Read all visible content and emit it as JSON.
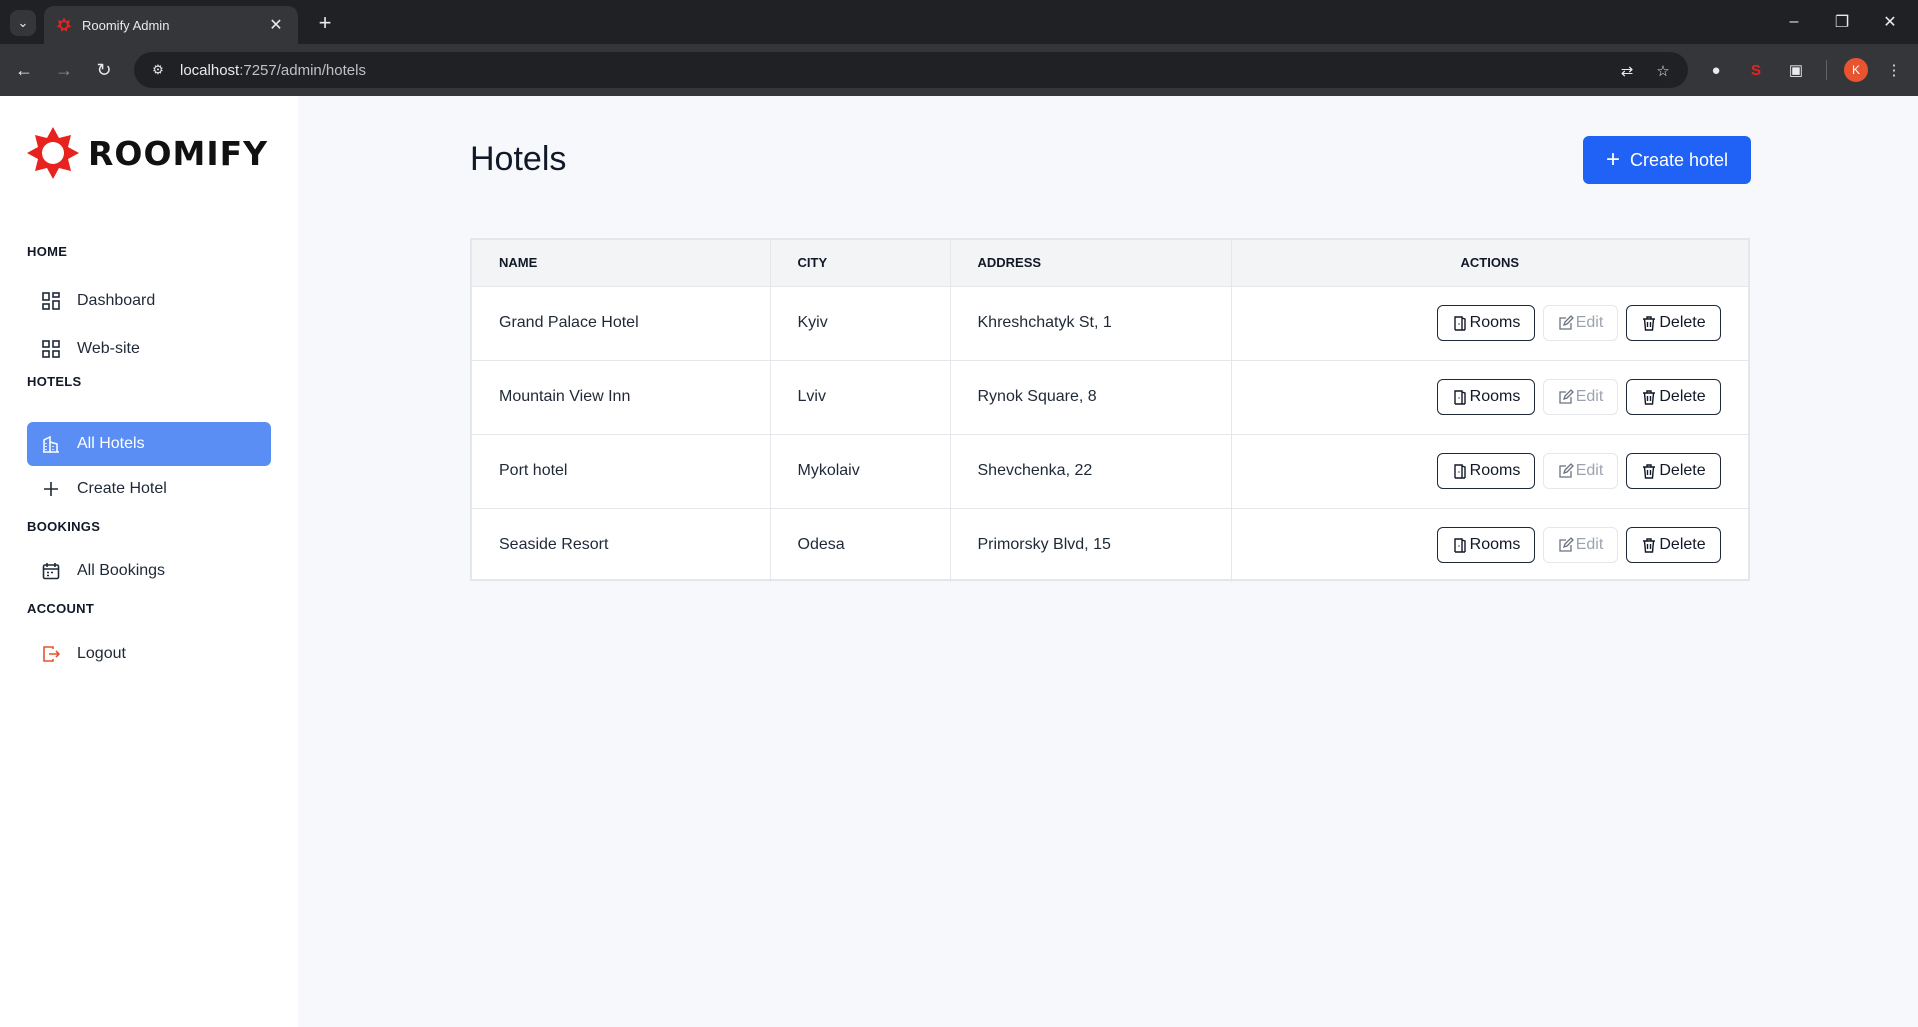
{
  "browser": {
    "tab_title": "Roomify Admin",
    "url_host": "localhost",
    "url_path": ":7257/admin/hotels",
    "profile_initial": "K"
  },
  "sidebar": {
    "logo_text": "ROOMIFY",
    "sections": [
      {
        "title": "HOME",
        "items": [
          {
            "label": "Dashboard",
            "icon": "dashboard-icon"
          },
          {
            "label": "Web-site",
            "icon": "website-icon"
          }
        ]
      },
      {
        "title": "HOTELS",
        "items": [
          {
            "label": "All Hotels",
            "icon": "building-icon",
            "active": true
          },
          {
            "label": "Create Hotel",
            "icon": "plus-icon"
          }
        ]
      },
      {
        "title": "BOOKINGS",
        "items": [
          {
            "label": "All Bookings",
            "icon": "calendar-icon"
          }
        ]
      },
      {
        "title": "ACCOUNT",
        "items": [
          {
            "label": "Logout",
            "icon": "logout-icon"
          }
        ]
      }
    ]
  },
  "main": {
    "title": "Hotels",
    "create_button": "Create hotel",
    "columns": [
      "NAME",
      "CITY",
      "ADDRESS",
      "ACTIONS"
    ],
    "rows": [
      {
        "name": "Grand Palace Hotel",
        "city": "Kyiv",
        "address": "Khreshchatyk St, 1"
      },
      {
        "name": "Mountain View Inn",
        "city": "Lviv",
        "address": "Rynok Square, 8"
      },
      {
        "name": "Port hotel",
        "city": "Mykolaiv",
        "address": "Shevchenka, 22"
      },
      {
        "name": "Seaside Resort",
        "city": "Odesa",
        "address": "Primorsky Blvd, 15"
      }
    ],
    "row_actions": {
      "rooms": "Rooms",
      "edit": "Edit",
      "delete": "Delete"
    }
  },
  "colors": {
    "primary": "#1f62f5",
    "active_nav": "#5b8ef5",
    "brand_red": "#e8231f",
    "logout_icon": "#e8542f"
  }
}
